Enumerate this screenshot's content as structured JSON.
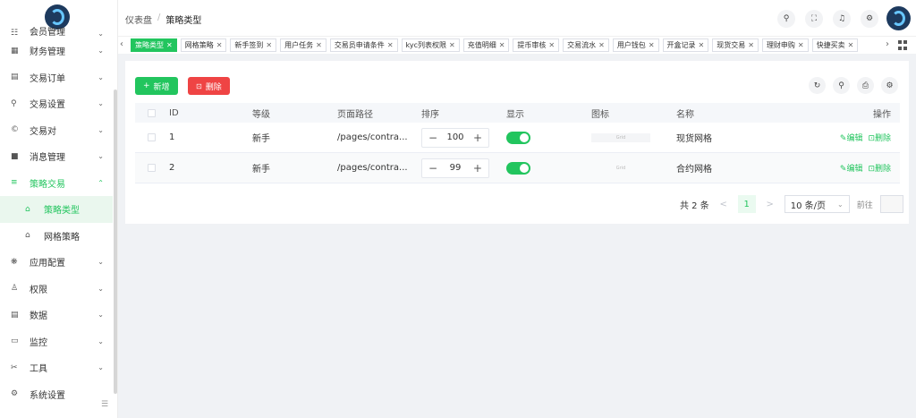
{
  "sidebar": {
    "items": [
      {
        "icon": "☷",
        "label": "会员管理",
        "arrow": "⌄",
        "partial": true
      },
      {
        "icon": "▦",
        "label": "财务管理",
        "arrow": "⌄"
      },
      {
        "icon": "▤",
        "label": "交易订单",
        "arrow": "⌄"
      },
      {
        "icon": "⚲",
        "label": "交易设置",
        "arrow": "⌄"
      },
      {
        "icon": "©",
        "label": "交易对",
        "arrow": "⌄"
      },
      {
        "icon": "■",
        "label": "消息管理",
        "arrow": "⌄"
      },
      {
        "icon": "≡",
        "label": "策略交易",
        "arrow": "⌃",
        "active": true
      },
      {
        "icon": "⌂",
        "label": "策略类型",
        "sub": true,
        "sub_active": true
      },
      {
        "icon": "⌂",
        "label": "网格策略",
        "sub": true
      },
      {
        "icon": "❋",
        "label": "应用配置",
        "arrow": "⌄"
      },
      {
        "icon": "♙",
        "label": "权限",
        "arrow": "⌄"
      },
      {
        "icon": "▤",
        "label": "数据",
        "arrow": "⌄"
      },
      {
        "icon": "▭",
        "label": "监控",
        "arrow": "⌄"
      },
      {
        "icon": "✂",
        "label": "工具",
        "arrow": "⌄"
      },
      {
        "icon": "⚙",
        "label": "系统设置",
        "arrow": ""
      }
    ],
    "collapse_icon": "☰"
  },
  "header": {
    "breadcrumb": [
      "仪表盘",
      "策略类型"
    ],
    "breadcrumb_sep": "/",
    "icons": [
      "search-icon",
      "fullscreen-icon",
      "bell-icon",
      "settings-icon"
    ]
  },
  "tabs": [
    {
      "label": "策略类型",
      "active": true
    },
    {
      "label": "网格策略"
    },
    {
      "label": "新手签到"
    },
    {
      "label": "用户任务"
    },
    {
      "label": "交易员申请条件"
    },
    {
      "label": "kyc列表权限"
    },
    {
      "label": "充值明细"
    },
    {
      "label": "提币审核"
    },
    {
      "label": "交易流水"
    },
    {
      "label": "用户钱包"
    },
    {
      "label": "开盒记录"
    },
    {
      "label": "现货交易"
    },
    {
      "label": "理财申购"
    },
    {
      "label": "快捷买卖"
    }
  ],
  "toolbar": {
    "add_label": "新增",
    "add_icon": "+",
    "delete_label": "删除",
    "delete_icon": "🗑"
  },
  "table": {
    "headers": {
      "id": "ID",
      "level": "等级",
      "path": "页面路径",
      "sort": "排序",
      "show": "显示",
      "icon": "图标",
      "name": "名称",
      "op": "操作"
    },
    "rows": [
      {
        "id": "1",
        "level": "新手",
        "path": "/pages/contra...",
        "sort": "100",
        "show": true,
        "icon_alt": "Grid",
        "name": "现货网格",
        "edit": "✎编辑",
        "del": "⊡删除"
      },
      {
        "id": "2",
        "level": "新手",
        "path": "/pages/contra...",
        "sort": "99",
        "show": true,
        "icon_alt": "Grid",
        "name": "合约网格",
        "edit": "✎编辑",
        "del": "⊡删除"
      }
    ],
    "stepper_minus": "−",
    "stepper_plus": "+"
  },
  "pagination": {
    "total": "共 2 条",
    "prev": "<",
    "current": "1",
    "next": ">",
    "page_size": "10 条/页",
    "goto": "前往"
  },
  "colors": {
    "accent": "#22c55e",
    "danger": "#ef4444"
  }
}
